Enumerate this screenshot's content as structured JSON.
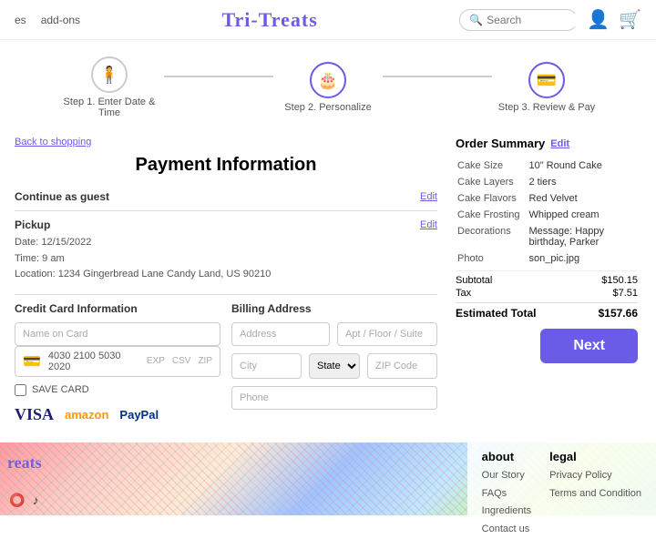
{
  "header": {
    "nav_items": [
      "es",
      "add-ons"
    ],
    "logo": "Tri-Treats",
    "search_placeholder": "Search",
    "user_icon": "👤",
    "cart_icon": "🛒"
  },
  "steps": [
    {
      "id": "step1",
      "label": "Step 1. Enter Date & Time",
      "icon": "🧍",
      "active": false
    },
    {
      "id": "step2",
      "label": "Step 2. Personalize",
      "icon": "🎂",
      "active": false
    },
    {
      "id": "step3",
      "label": "Step 3. Review & Pay",
      "icon": "💳",
      "active": true
    }
  ],
  "back_link": "Back to shopping",
  "section_title": "Payment Information",
  "continue_guest": {
    "label": "Continue as guest",
    "edit_label": "Edit"
  },
  "pickup": {
    "label": "Pickup",
    "edit_label": "Edit",
    "date": "Date: 12/15/2022",
    "time": "Time: 9 am",
    "location": "Location: 1234 Gingerbread Lane Candy Land, US 90210"
  },
  "credit_card": {
    "title": "Credit Card Information",
    "name_placeholder": "Name on Card",
    "card_icon": "💳",
    "card_number": "4030 2100 5030 2020",
    "exp_label": "EXP",
    "csv_label": "CSV",
    "zip_label": "ZIP",
    "save_card_label": "SAVE CARD"
  },
  "payment_logos": {
    "visa": "VISA",
    "amazon": "amazon",
    "paypal": "PayPal"
  },
  "billing": {
    "title": "Billing Address",
    "address_placeholder": "Address",
    "apt_placeholder": "Apt / Floor / Suite",
    "city_placeholder": "City",
    "state_placeholder": "State",
    "zip_placeholder": "ZIP Code",
    "phone_placeholder": "Phone"
  },
  "order_summary": {
    "title": "Order Summary",
    "edit_label": "Edit",
    "rows": [
      {
        "label": "Cake Size",
        "value": "10\" Round Cake"
      },
      {
        "label": "Cake Layers",
        "value": "2 tiers"
      },
      {
        "label": "Cake Flavors",
        "value": "Red Velvet"
      },
      {
        "label": "Cake Frosting",
        "value": "Whipped cream"
      },
      {
        "label": "Decorations",
        "value": "Message: Happy birthday, Parker"
      },
      {
        "label": "Photo",
        "value": "son_pic.jpg"
      }
    ],
    "subtotal_label": "Subtotal",
    "subtotal_value": "$150.15",
    "tax_label": "Tax",
    "tax_value": "$7.51",
    "total_label": "Estimated Total",
    "total_value": "$157.66"
  },
  "next_button": "Next",
  "footer": {
    "logo": "reats",
    "about": {
      "title": "about",
      "links": [
        "Our Story",
        "FAQs",
        "Ingredients",
        "Contact us"
      ]
    },
    "legal": {
      "title": "legal",
      "links": [
        "Privacy Policy",
        "Terms and Condition"
      ]
    }
  }
}
